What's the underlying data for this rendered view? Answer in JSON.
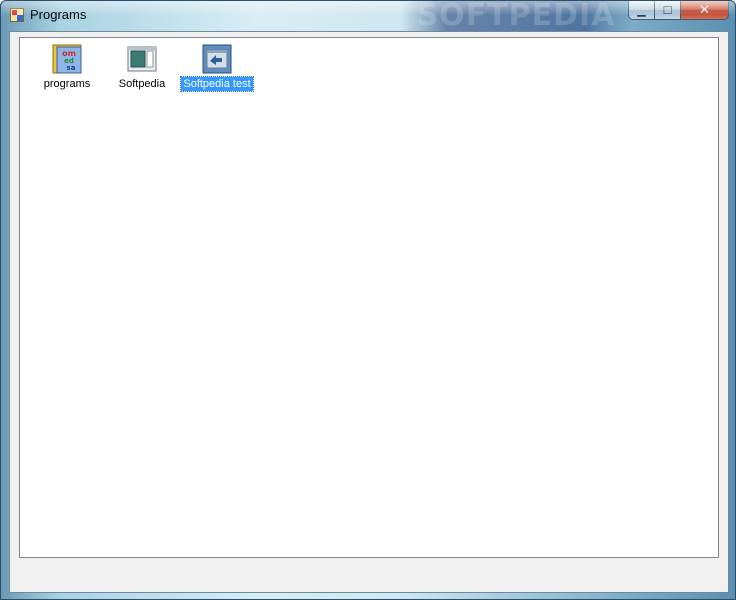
{
  "window": {
    "title": "Programs",
    "watermark": "SOFTPEDIA",
    "controls": {
      "minimize": "▁",
      "maximize": "☐",
      "close": "✕"
    }
  },
  "items": [
    {
      "label": "programs",
      "icon": "programs-app-icon",
      "selected": false
    },
    {
      "label": "Softpedia",
      "icon": "window-app-icon",
      "selected": false
    },
    {
      "label": "Softpedia test",
      "icon": "shortcut-app-icon",
      "selected": true
    }
  ],
  "colors": {
    "selection": "#3399ff",
    "list_bg": "#ffffff",
    "client_bg": "#f0f0f0"
  }
}
